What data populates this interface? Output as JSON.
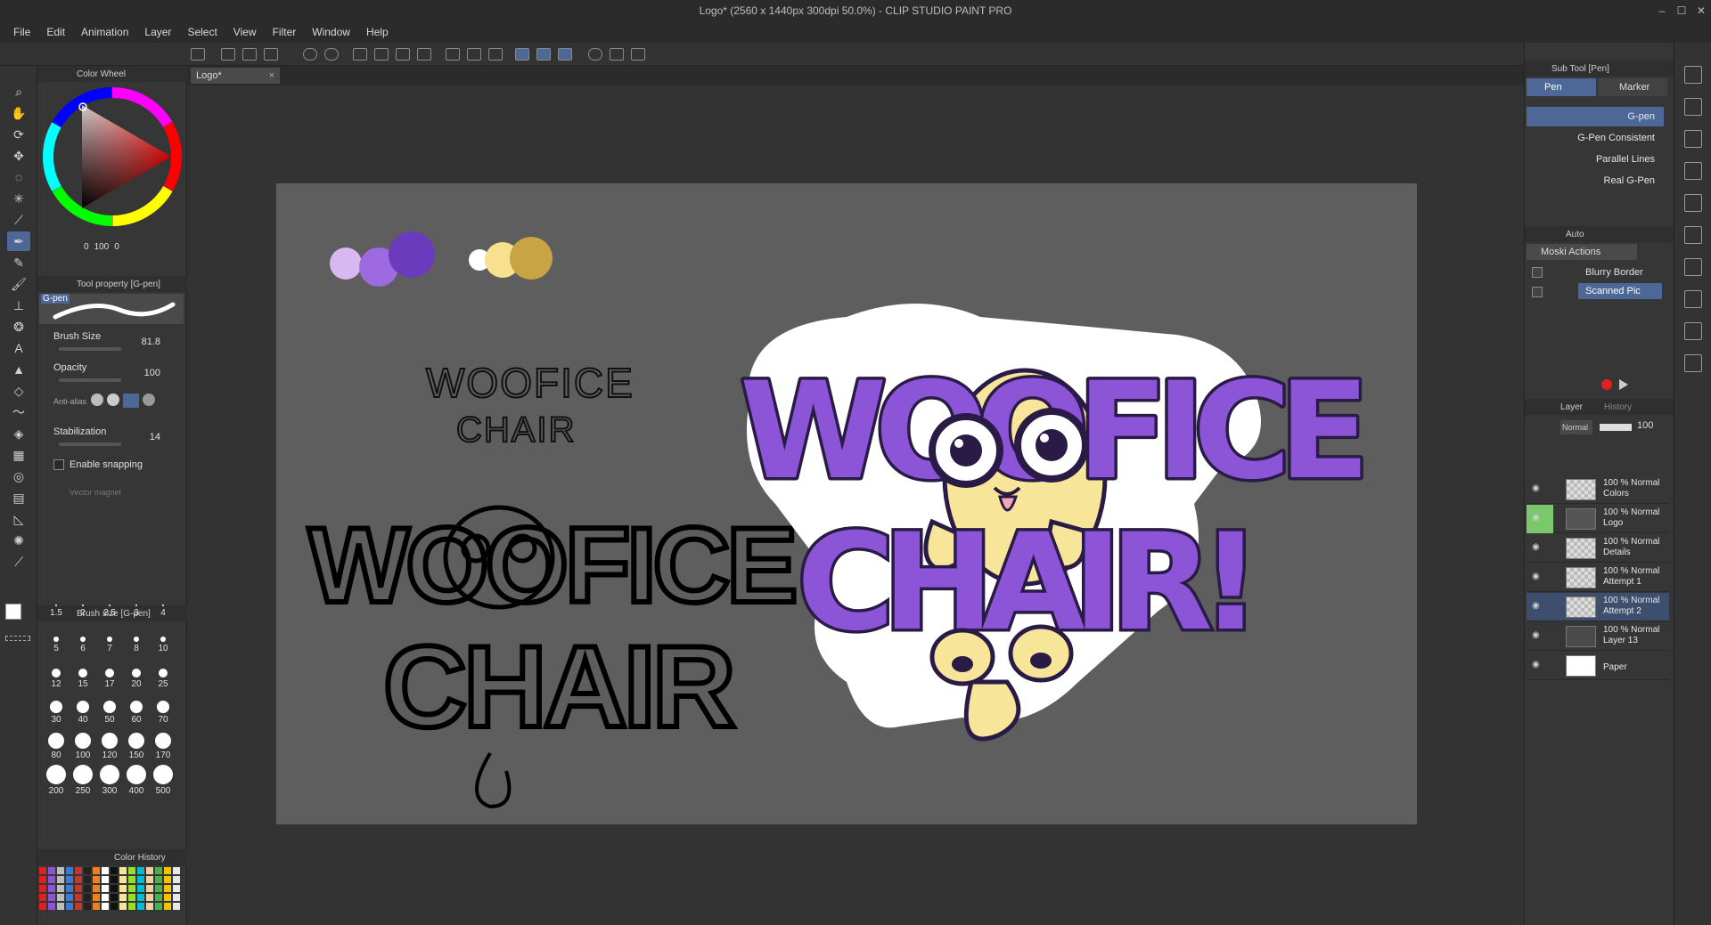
{
  "titlebar": {
    "title": "Logo* (2560 x 1440px 300dpi 50.0%)  - CLIP STUDIO PAINT PRO",
    "minimize": "–",
    "maximize": "☐",
    "close": "✕"
  },
  "menu": [
    "File",
    "Edit",
    "Animation",
    "Layer",
    "Select",
    "View",
    "Filter",
    "Window",
    "Help"
  ],
  "tabs": {
    "doc": "Logo*",
    "close": "×"
  },
  "color_wheel": {
    "title": "Color Wheel",
    "readout": [
      "0",
      "100",
      "0"
    ]
  },
  "tool_property": {
    "title": "Tool property [G-pen]",
    "preset_name": "G-pen",
    "brush_size_label": "Brush Size",
    "brush_size_value": "81.8",
    "opacity_label": "Opacity",
    "opacity_value": "100",
    "anti_alias_label": "Anti-alias",
    "stabilization_label": "Stabilization",
    "stabilization_value": "14",
    "snapping_label": "Enable snapping",
    "vector_magnet_label": "Vector magnet"
  },
  "brush_size_panel": {
    "title": "Brush size [G-pen]",
    "sizes": [
      "1.5",
      "2",
      "2.5",
      "3",
      "4",
      "5",
      "6",
      "7",
      "8",
      "10",
      "12",
      "15",
      "17",
      "20",
      "25",
      "30",
      "40",
      "50",
      "60",
      "70",
      "80",
      "100",
      "120",
      "150",
      "170",
      "200",
      "250",
      "300",
      "400",
      "500"
    ]
  },
  "color_history": {
    "title": "Color History"
  },
  "sub_tool": {
    "title": "Sub Tool [Pen]",
    "tabs": [
      "Pen",
      "Marker"
    ],
    "brushes": [
      "G-pen",
      "G-Pen Consistent",
      "Parallel Lines",
      "Real G-Pen"
    ]
  },
  "auto_actions": {
    "title": "Auto",
    "set_name": "Moski Actions",
    "items": [
      "Blurry Border",
      "Scanned Pic"
    ]
  },
  "layers": {
    "title": "Layer",
    "history_tab": "History",
    "blend_mode": "Normal",
    "opacity": "100",
    "rows": [
      {
        "mode": "100 % Normal",
        "name": "Colors"
      },
      {
        "mode": "100 % Normal",
        "name": "Logo"
      },
      {
        "mode": "100 % Normal",
        "name": "Details"
      },
      {
        "mode": "100 % Normal",
        "name": "Attempt 1"
      },
      {
        "mode": "100 % Normal",
        "name": "Attempt 2"
      },
      {
        "mode": "100 % Normal",
        "name": "Layer 13"
      },
      {
        "mode": "",
        "name": "Paper"
      }
    ]
  },
  "artwork": {
    "sketch_title_1": "WOOFICE",
    "sketch_title_2": "CHAIR",
    "logo_line_1": "WOOFICE",
    "logo_line_2": "CHAIR!",
    "palette_purples": [
      "#d9b8f2",
      "#9d6ae0",
      "#6b3bbd"
    ],
    "palette_yellows": [
      "#ffffff",
      "#f7e08e",
      "#c9a445"
    ]
  },
  "colors": {
    "accent": "#4d6797",
    "canvas": "#5e5e5e",
    "logo_purple": "#8c55d8",
    "logo_yellow": "#f7e59a",
    "outline": "#2a1b46"
  }
}
